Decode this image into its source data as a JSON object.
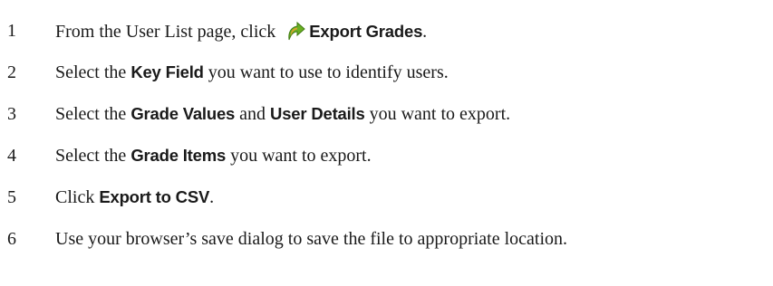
{
  "steps": [
    {
      "number": "1",
      "parts": {
        "t1": "From the User List page, click ",
        "icon": "export-grades-icon",
        "b1": "Export Grades",
        "t2": "."
      }
    },
    {
      "number": "2",
      "parts": {
        "t1": "Select the ",
        "b1": "Key Field",
        "t2": " you want to use to identify users."
      }
    },
    {
      "number": "3",
      "parts": {
        "t1": "Select the ",
        "b1": "Grade Values",
        "t2": " and ",
        "b2": "User Details",
        "t3": " you want to export."
      }
    },
    {
      "number": "4",
      "parts": {
        "t1": "Select the ",
        "b1": "Grade Items",
        "t2": " you want to export."
      }
    },
    {
      "number": "5",
      "parts": {
        "t1": "Click ",
        "b1": "Export to CSV",
        "t2": "."
      }
    },
    {
      "number": "6",
      "parts": {
        "t1": "Use your browser’s save dialog to save the file to appropriate location."
      }
    }
  ],
  "colors": {
    "icon_green": "#6ab023",
    "icon_orange": "#f0a030",
    "text": "#1a1a1a"
  }
}
